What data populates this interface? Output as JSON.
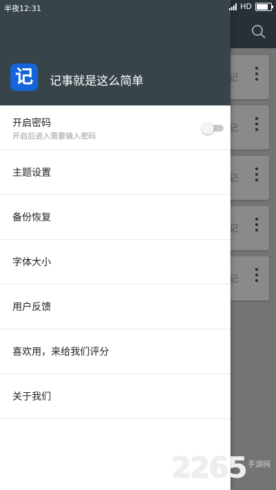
{
  "status_bar": {
    "time": "半夜12:31",
    "network": "HD",
    "battery_level": 0.8
  },
  "background": {
    "cards": [
      {
        "text": "记"
      },
      {
        "text": "记"
      },
      {
        "text": "记"
      },
      {
        "text": "记"
      },
      {
        "text": "记"
      }
    ]
  },
  "drawer": {
    "logo_char": "记",
    "app_title": "记事就是这么简单",
    "items": [
      {
        "label": "开启密码",
        "sub": "开启后进入需要输入密码",
        "toggle": false
      },
      {
        "label": "主题设置"
      },
      {
        "label": "备份恢复"
      },
      {
        "label": "字体大小"
      },
      {
        "label": "用户反馈"
      },
      {
        "label": "喜欢用，来给我们评分"
      },
      {
        "label": "关于我们"
      }
    ]
  },
  "watermark": {
    "number": "2265",
    "sub": "手游网"
  },
  "colors": {
    "header": "#37444a",
    "toolbar": "#273036",
    "logo": "#1565d8",
    "scrim": "#747474"
  }
}
